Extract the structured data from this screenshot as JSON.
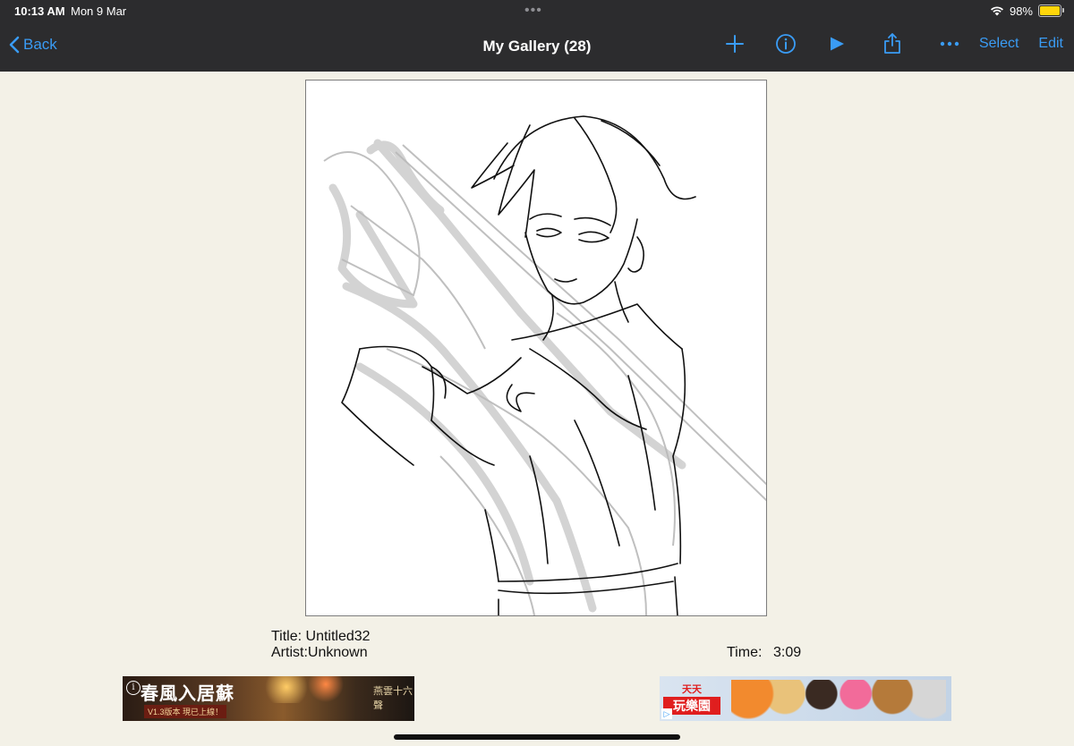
{
  "status": {
    "time": "10:13 AM",
    "date": "Mon 9 Mar",
    "battery": "98%",
    "battery_level": 0.98
  },
  "nav": {
    "back_label": "Back",
    "title": "My Gallery (28)",
    "select_label": "Select",
    "edit_label": "Edit",
    "icons": [
      "plus-icon",
      "info-icon",
      "play-icon",
      "share-icon",
      "more-icon"
    ]
  },
  "artwork": {
    "title_line": "Title: Untitled32",
    "artist_line": "Artist:Unknown",
    "time_label": "Time:",
    "time_value": "3:09"
  },
  "ads": {
    "left_text": "春風入居蘇",
    "left_sub": "V1.3版本  現已上線！",
    "left_tag": "燕雲十六聲",
    "right_text": "天天",
    "right_text2": "玩樂園"
  },
  "colors": {
    "accent": "#3a9cf5",
    "nav_bg": "#2c2c2e",
    "page_bg": "#f3f1e7",
    "battery": "#ffd60a"
  }
}
